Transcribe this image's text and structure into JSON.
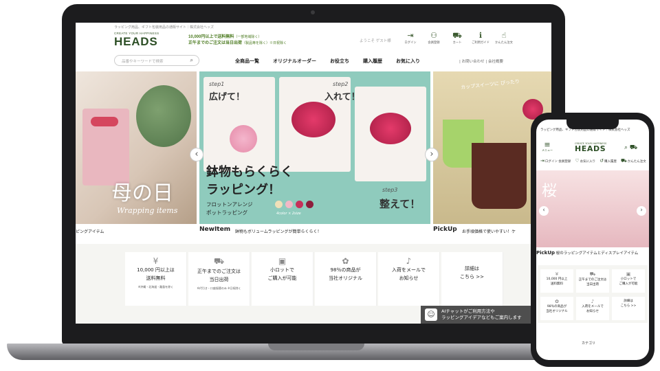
{
  "desktop": {
    "topbar": "ラッピング用品、ギフト包装用品の通販サイト｜株式会社ヘッズ",
    "logo_small": "CREATE YOUR HAPPINESS",
    "logo": "HEADS",
    "promo1": "10,000円以上で送料無料",
    "promo1_note": "（一部地域除く）",
    "promo2": "正午までのご注文は当日出荷",
    "promo2_note": "（製品等を除く）※日祝除く",
    "welcome": "ようこそ ゲスト様",
    "header_icons": [
      {
        "icon": "login-icon",
        "glyph": "⇥",
        "label": "ログイン"
      },
      {
        "icon": "member-icon",
        "glyph": "⚇",
        "label": "会員登録"
      },
      {
        "icon": "cart-icon",
        "glyph": "⛟",
        "label": "カート"
      },
      {
        "icon": "guide-icon",
        "glyph": "ℹ",
        "label": "ご利用ガイド"
      },
      {
        "icon": "easy-order-icon",
        "glyph": "☝",
        "label": "かんたん注文"
      }
    ],
    "search_placeholder": "品番やキーワードで検索",
    "nav": [
      "全商品一覧",
      "オリジナルオーダー",
      "お役立ち",
      "購入履歴",
      "お気に入り"
    ],
    "subnav": [
      "お問い合わせ",
      "会社概要"
    ],
    "hero": {
      "slide_left_title": "母の日",
      "slide_left_sub": "Wrapping items",
      "step1": "step1",
      "step1_text": "広げて！",
      "step2": "step2",
      "step2_text": "入れて！",
      "step3": "step3",
      "step3_text": "整えて！",
      "catch": "鉢物もらくらく\nラッピング！",
      "cap1": "フロットンアレンジ",
      "cap2": "ポットラッピング",
      "colors_note": "4color × 2size",
      "slide_right_text": "カップスイーツに ぴったり"
    },
    "captions": {
      "left": "ピングアイテム",
      "new_label": "NewItem",
      "new_text": "鉢物もボリュームラッピングが簡単らくらく！",
      "pick_label": "PickUp",
      "pick_text": "お手頃価格で使いやすい！ケ"
    },
    "features": [
      {
        "icon": "yen-icon",
        "glyph": "¥",
        "l1": "10,000 円以上は",
        "l2": "送料無料",
        "note": "※沖縄・北海道・離島を除く"
      },
      {
        "icon": "truck-icon",
        "glyph": "⛟",
        "l1": "正午までのご注文は",
        "l2": "当日出荷",
        "note": "※代引き・口座振替のみ ※日祝除く"
      },
      {
        "icon": "box-icon",
        "glyph": "▣",
        "l1": "小ロットで",
        "l2": "ご購入が可能",
        "note": ""
      },
      {
        "icon": "original-icon",
        "glyph": "✿",
        "l1": "98％の商品が",
        "l2": "当社オリジナル",
        "note": ""
      },
      {
        "icon": "bell-icon",
        "glyph": "♪",
        "l1": "入荷をメールで",
        "l2": "お知らせ",
        "note": ""
      },
      {
        "icon": "",
        "glyph": "",
        "l1": "詳細は",
        "l2": "こちら >>",
        "note": ""
      }
    ],
    "chat": {
      "l1": "AIチャットがご利用方法や",
      "l2": "ラッピングアイデアなどもご案内します"
    }
  },
  "mobile": {
    "topbar": "ラッピング用品、ギフト包装用品の通販サイト｜株式会社ヘッズ",
    "menu": "メニュー",
    "logo_small": "CREATE YOUR HAPPINESS",
    "logo": "HEADS",
    "nav": [
      {
        "icon": "login-icon",
        "glyph": "⇥",
        "label": "ログイン 会員登録"
      },
      {
        "icon": "heart-icon",
        "glyph": "♡",
        "label": "お気に入り"
      },
      {
        "icon": "history-icon",
        "glyph": "↺",
        "label": "購入履歴"
      },
      {
        "icon": "cart-icon",
        "glyph": "⛟",
        "label": "かんたん注文"
      }
    ],
    "hero_text": "桜",
    "pick_label": "PickUp",
    "pick_text": "桜のラッピングアイテムとディスプレイアイテム",
    "features": [
      {
        "glyph": "¥",
        "l1": "10,000 円以上",
        "l2": "送料無料"
      },
      {
        "glyph": "⛟",
        "l1": "正午までのご注文は",
        "l2": "当日出荷"
      },
      {
        "glyph": "▣",
        "l1": "小ロットで",
        "l2": "ご購入が可能"
      },
      {
        "glyph": "✿",
        "l1": "98％の商品が",
        "l2": "当社オリジナル"
      },
      {
        "glyph": "♪",
        "l1": "入荷をメールで",
        "l2": "お知らせ"
      },
      {
        "glyph": "",
        "l1": "詳細は",
        "l2": "こちら >>"
      }
    ],
    "tail": "カテゴリ"
  }
}
